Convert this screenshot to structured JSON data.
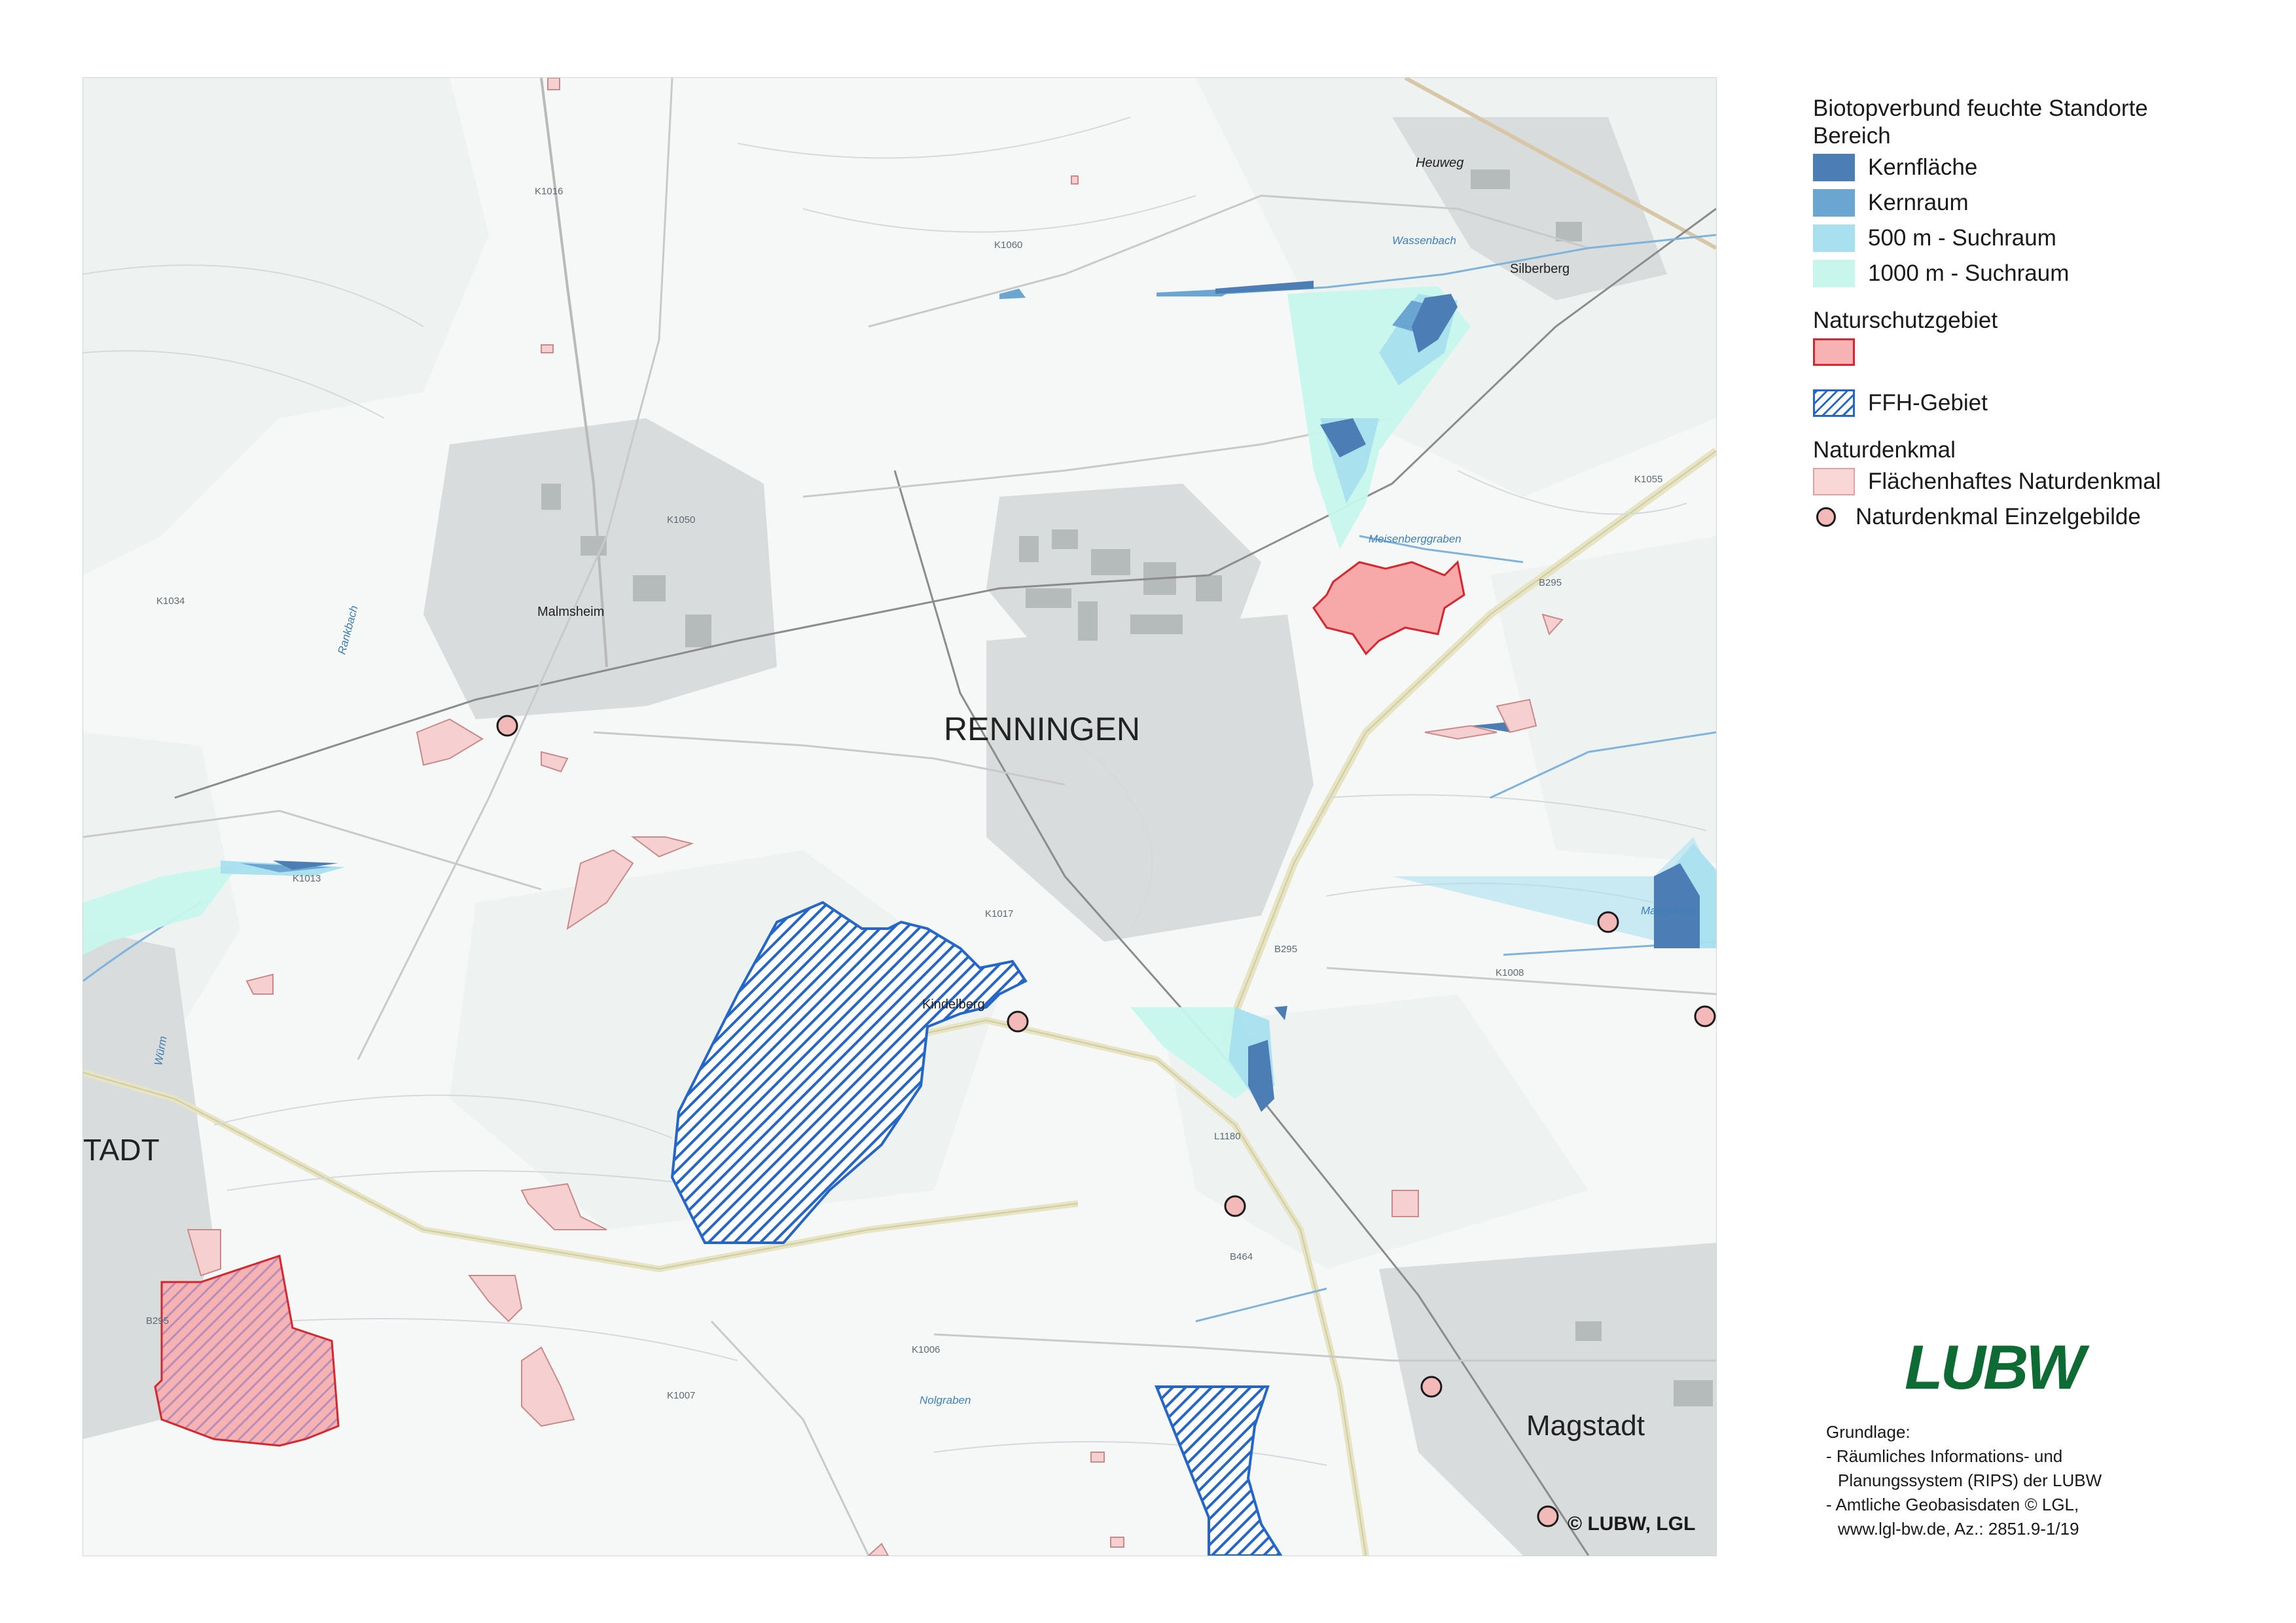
{
  "legend": {
    "section_biotop": "Biotopverbund feuchte Standorte",
    "section_bereich": "Bereich",
    "kernflaeche": "Kernfläche",
    "kernraum": "Kernraum",
    "suchraum_500": "500 m - Suchraum",
    "suchraum_1000": "1000 m - Suchraum",
    "section_nsg": "Naturschutzgebiet",
    "ffh": "FFH-Gebiet",
    "section_naturdenkmal": "Naturdenkmal",
    "nd_flaeche": "Flächenhaftes Naturdenkmal",
    "nd_einzel": "Naturdenkmal Einzelgebilde"
  },
  "colors": {
    "kernflaeche": "#4d7db5",
    "kernraum": "#6aa6d1",
    "suchraum_500": "#a8e0f0",
    "suchraum_1000": "#c7f7ec",
    "nsg_fill": "#f7b3b3",
    "nsg_border": "#d6262e",
    "ffh": "#2566c9",
    "naturdenkmal": "#fad7d7"
  },
  "map": {
    "places": {
      "renningen": "RENNINGEN",
      "magstadt": "Magstadt",
      "stadt_partial": "TADT",
      "malmsheim": "Malmsheim",
      "heuweg": "Heuweg",
      "silberberg": "Silberberg",
      "kindelberg": "Kindelberg"
    },
    "roads": {
      "k1016": "K1016",
      "k1060": "K1060",
      "k1050": "K1050",
      "k1034": "K1034",
      "k1013": "K1013",
      "k1017": "K1017",
      "k1008": "K1008",
      "k1007": "K1007",
      "b295_a": "B295",
      "b295_b": "B295",
      "b295_c": "B295",
      "b464": "B464",
      "l1180": "L1180",
      "k1006": "K1006",
      "k1055": "K1055"
    },
    "waters": {
      "wassenbach": "Wassenbach",
      "meisenberggraben": "Meisenberggraben",
      "rankbach": "Rankbach",
      "maugraben": "Maugraben",
      "nolgraben": "Nolgraben",
      "wurm": "Würm"
    }
  },
  "logo": "LUBW",
  "source": {
    "heading": "Grundlage:",
    "line1": "- Räumliches Informations- und",
    "line2": "Planungssystem (RIPS) der LUBW",
    "line3": "- Amtliche Geobasisdaten © LGL,",
    "line4": "www.lgl-bw.de, Az.: 2851.9-1/19"
  },
  "copyright": "© LUBW, LGL"
}
